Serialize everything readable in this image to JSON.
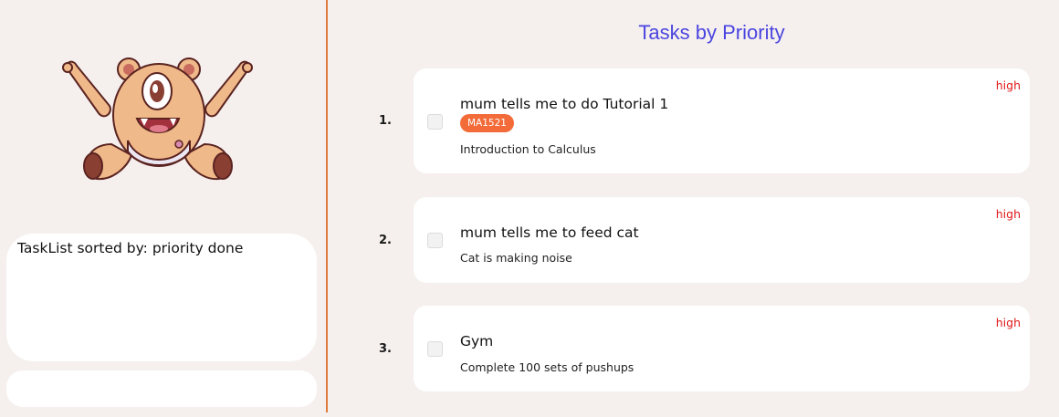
{
  "sidebar": {
    "result_text": "TaskList sorted by: priority done",
    "command_placeholder": ""
  },
  "main": {
    "title": "Tasks by Priority",
    "tasks": [
      {
        "index": "1.",
        "name": "mum tells me to do Tutorial 1",
        "tag": "MA1521",
        "description": "Introduction to Calculus",
        "priority": "high",
        "done": false
      },
      {
        "index": "2.",
        "name": "mum tells me to feed cat",
        "tag": "",
        "description": "Cat is making noise",
        "priority": "high",
        "done": false
      },
      {
        "index": "3.",
        "name": "Gym",
        "tag": "",
        "description": "Complete 100 sets of pushups",
        "priority": "high",
        "done": false
      }
    ]
  },
  "colors": {
    "accent": "#4b45e0",
    "divider": "#e07a3c",
    "tag": "#f26b38",
    "priority_high": "#e01818"
  },
  "icons": {
    "mascot": "one-eyed-monster-mascot"
  }
}
